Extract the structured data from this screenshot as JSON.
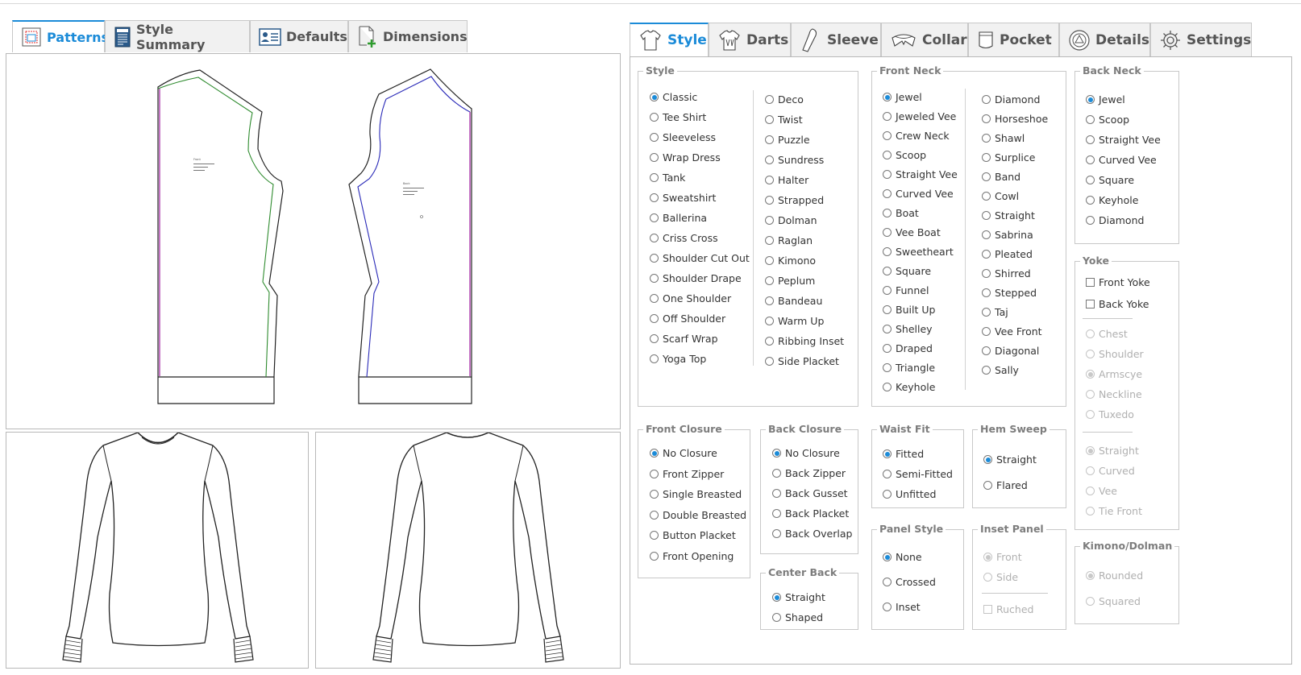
{
  "left_tabs": [
    {
      "label": "Patterns",
      "icon": "pattern-icon",
      "active": true
    },
    {
      "label": "Style Summary",
      "icon": "summary-icon",
      "active": false
    },
    {
      "label": "Defaults",
      "icon": "defaults-card-icon",
      "active": false
    },
    {
      "label": "Dimensions",
      "icon": "dimensions-icon",
      "active": false
    }
  ],
  "right_tabs": [
    {
      "label": "Style",
      "icon": "shirt-icon",
      "active": true
    },
    {
      "label": "Darts",
      "icon": "darts-icon",
      "active": false
    },
    {
      "label": "Sleeve",
      "icon": "sleeve-icon",
      "active": false
    },
    {
      "label": "Collar",
      "icon": "collar-icon",
      "active": false
    },
    {
      "label": "Pocket",
      "icon": "pocket-icon",
      "active": false
    },
    {
      "label": "Details",
      "icon": "details-icon",
      "active": false
    },
    {
      "label": "Settings",
      "icon": "gear-icon",
      "active": false
    }
  ],
  "style": {
    "legend": "Style",
    "col1": [
      "Classic",
      "Tee Shirt",
      "Sleeveless",
      "Wrap Dress",
      "Tank",
      "Sweatshirt",
      "Ballerina",
      "Criss Cross",
      "Shoulder Cut Out",
      "Shoulder Drape",
      "One Shoulder",
      "Off Shoulder",
      "Scarf Wrap",
      "Yoga Top"
    ],
    "col2": [
      "Deco",
      "Twist",
      "Puzzle",
      "Sundress",
      "Halter",
      "Strapped",
      "Dolman",
      "Raglan",
      "Kimono",
      "Peplum",
      "Bandeau",
      "Warm Up",
      "Ribbing Inset",
      "Side Placket"
    ],
    "selected": "Classic"
  },
  "front_neck": {
    "legend": "Front Neck",
    "col1": [
      "Jewel",
      "Jeweled Vee",
      "Crew Neck",
      "Scoop",
      "Straight Vee",
      "Curved Vee",
      "Boat",
      "Vee Boat",
      "Sweetheart",
      "Square",
      "Funnel",
      "Built Up",
      "Shelley",
      "Draped",
      "Triangle",
      "Keyhole"
    ],
    "col2": [
      "Diamond",
      "Horseshoe",
      "Shawl",
      "Surplice",
      "Band",
      "Cowl",
      "Straight",
      "Sabrina",
      "Pleated",
      "Shirred",
      "Stepped",
      "Taj",
      "Vee Front",
      "Diagonal",
      "Sally"
    ],
    "selected": "Jewel"
  },
  "back_neck": {
    "legend": "Back Neck",
    "options": [
      "Jewel",
      "Scoop",
      "Straight Vee",
      "Curved Vee",
      "Square",
      "Keyhole",
      "Diamond"
    ],
    "selected": "Jewel"
  },
  "yoke": {
    "legend": "Yoke",
    "checks": [
      "Front Yoke",
      "Back Yoke"
    ],
    "group1": [
      "Chest",
      "Shoulder",
      "Armscye",
      "Neckline",
      "Tuxedo"
    ],
    "group1_selected": "Armscye",
    "group2": [
      "Straight",
      "Curved",
      "Vee",
      "Tie Front"
    ],
    "group2_selected": "Straight"
  },
  "front_closure": {
    "legend": "Front Closure",
    "options": [
      "No Closure",
      "Front Zipper",
      "Single Breasted",
      "Double Breasted",
      "Button Placket",
      "Front Opening"
    ],
    "selected": "No Closure"
  },
  "back_closure": {
    "legend": "Back Closure",
    "options": [
      "No Closure",
      "Back Zipper",
      "Back Gusset",
      "Back Placket",
      "Back Overlap"
    ],
    "selected": "No Closure"
  },
  "center_back": {
    "legend": "Center Back",
    "options": [
      "Straight",
      "Shaped"
    ],
    "selected": "Straight"
  },
  "waist_fit": {
    "legend": "Waist Fit",
    "options": [
      "Fitted",
      "Semi-Fitted",
      "Unfitted"
    ],
    "selected": "Fitted"
  },
  "hem_sweep": {
    "legend": "Hem Sweep",
    "options": [
      "Straight",
      "Flared"
    ],
    "selected": "Straight"
  },
  "panel_style": {
    "legend": "Panel Style",
    "options": [
      "None",
      "Crossed",
      "Inset"
    ],
    "selected": "None"
  },
  "inset_panel": {
    "legend": "Inset Panel",
    "options": [
      "Front",
      "Side"
    ],
    "selected": "Front",
    "check": "Ruched"
  },
  "kimono_dolman": {
    "legend": "Kimono/Dolman",
    "options": [
      "Rounded",
      "Squared"
    ],
    "selected": "Rounded"
  },
  "colors": {
    "accent": "#1b8bd8",
    "front_seam": "#2e8b2e",
    "back_seam": "#2a2ab8",
    "grain": "#a020a0"
  }
}
